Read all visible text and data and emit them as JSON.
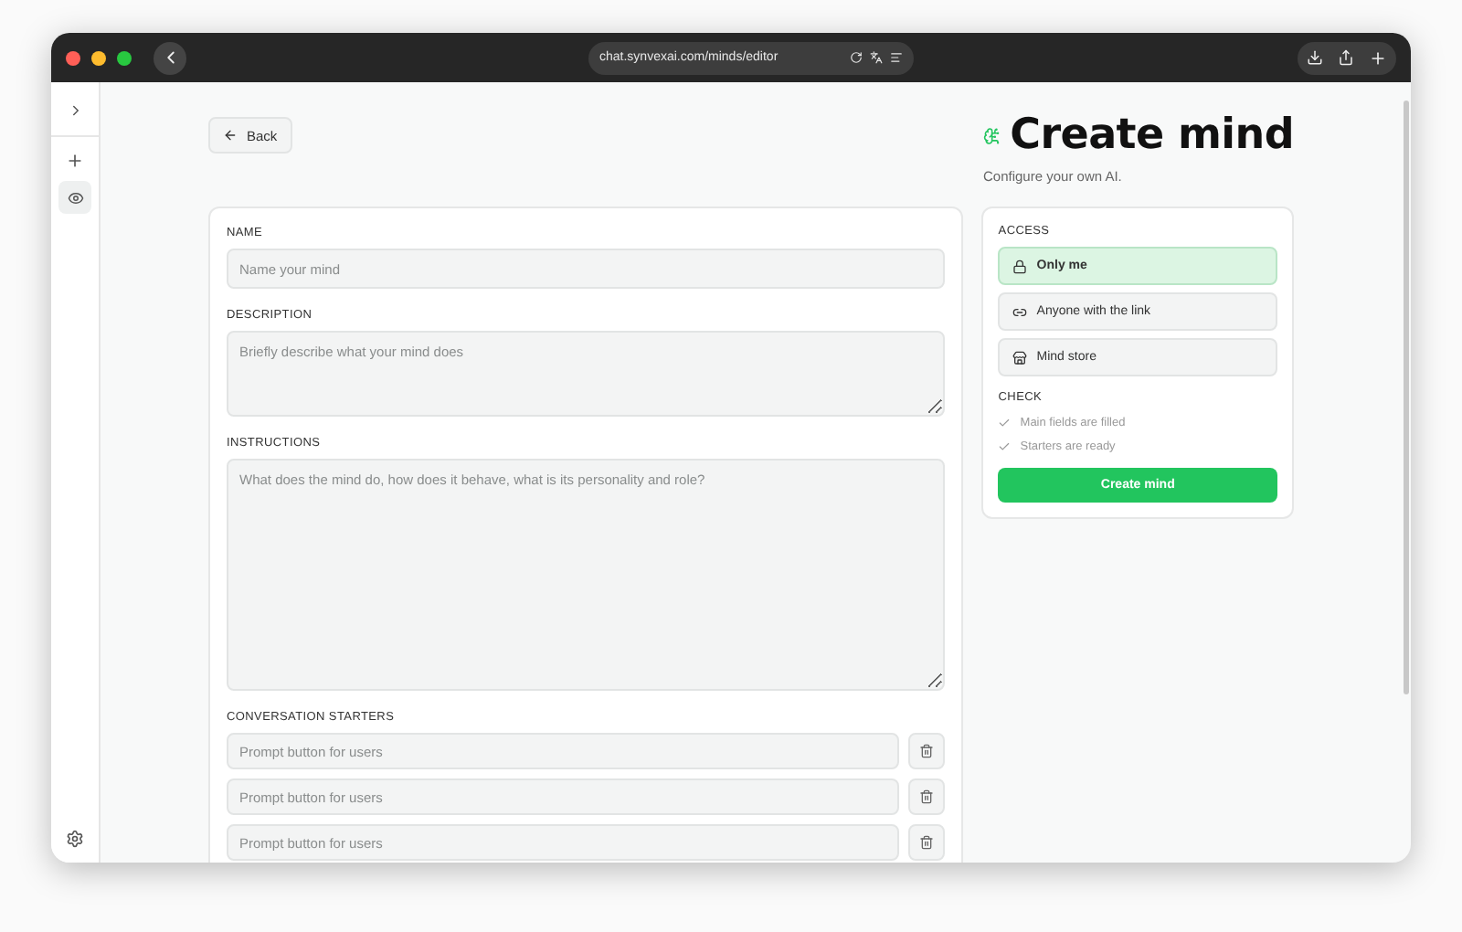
{
  "browser": {
    "url": "chat.synvexai.com/minds/editor"
  },
  "back_button": {
    "label": "Back"
  },
  "header": {
    "title": "Create mind",
    "subtitle": "Configure your own AI."
  },
  "form": {
    "fields": [
      {
        "label": "NAME",
        "kind": "input",
        "placeholder": "Name your mind"
      },
      {
        "label": "DESCRIPTION",
        "kind": "short_text",
        "placeholder": "Briefly describe what your mind does"
      },
      {
        "label": "INSTRUCTIONS",
        "kind": "long_text",
        "placeholder": "What does the mind do, how does it behave, what is its personality and role?"
      }
    ],
    "starters": {
      "label": "CONVERSATION STARTERS",
      "items": [
        {
          "placeholder": "Prompt button for users"
        },
        {
          "placeholder": "Prompt button for users"
        },
        {
          "placeholder": "Prompt button for users"
        }
      ]
    }
  },
  "access": {
    "label": "ACCESS",
    "options": [
      {
        "label": "Only me",
        "kind": "lock",
        "selected": true
      },
      {
        "label": "Anyone with the link",
        "kind": "link",
        "selected": false
      },
      {
        "label": "Mind store",
        "kind": "store",
        "selected": false
      }
    ]
  },
  "check": {
    "label": "CHECK",
    "items": [
      {
        "label": "Main fields are filled",
        "done": false
      },
      {
        "label": "Starters are ready",
        "done": false
      }
    ]
  },
  "create_button": {
    "label": "Create mind"
  }
}
